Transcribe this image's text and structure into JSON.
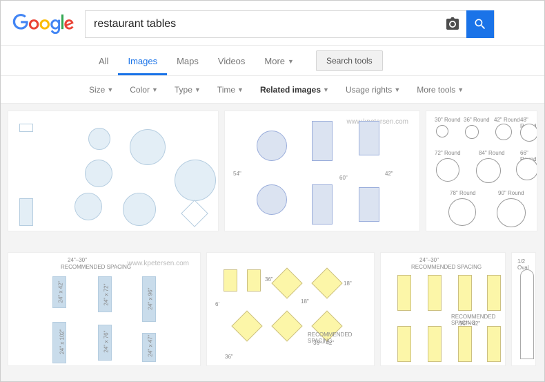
{
  "search": {
    "query": "restaurant tables",
    "placeholder": ""
  },
  "nav": {
    "all": "All",
    "images": "Images",
    "maps": "Maps",
    "videos": "Videos",
    "more": "More",
    "tools": "Search tools"
  },
  "filters": {
    "size": "Size",
    "color": "Color",
    "type": "Type",
    "time": "Time",
    "related": "Related images",
    "usage": "Usage rights",
    "moretools": "More tools"
  },
  "thumbs": {
    "wm": "www.kpetersen.com",
    "t1": "RECOMMENDED SPACING",
    "t2": "24\"–30\"",
    "t3": "36\"– 42\""
  }
}
